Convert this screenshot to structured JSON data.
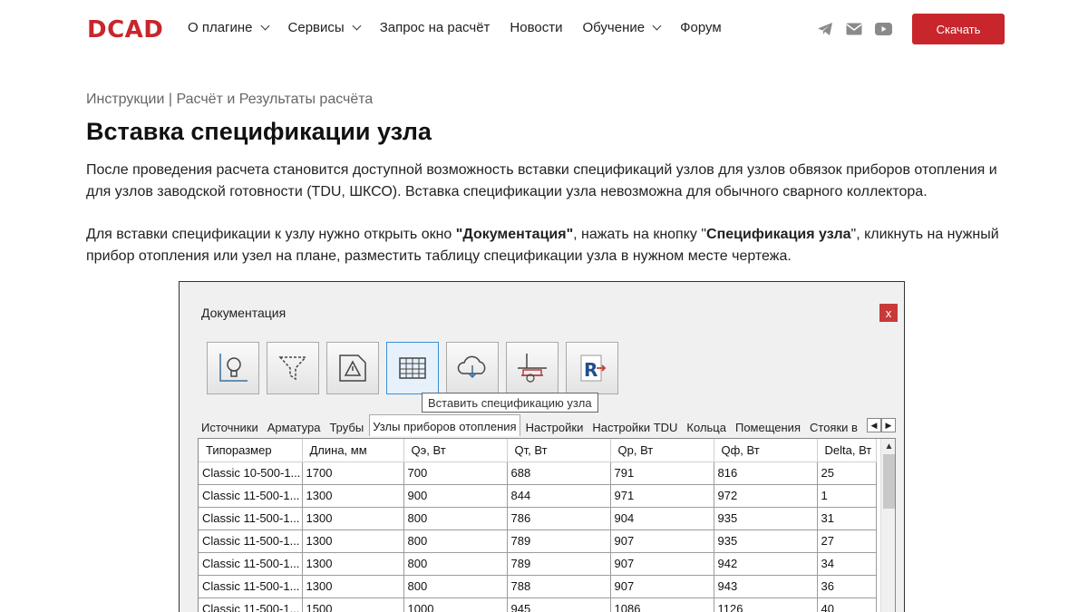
{
  "header": {
    "logo": "DCAD",
    "nav": [
      {
        "label": "О плагине",
        "dropdown": true
      },
      {
        "label": "Сервисы",
        "dropdown": true
      },
      {
        "label": "Запрос на расчёт",
        "dropdown": false
      },
      {
        "label": "Новости",
        "dropdown": false
      },
      {
        "label": "Обучение",
        "dropdown": true
      },
      {
        "label": "Форум",
        "dropdown": false
      }
    ],
    "social_icons": [
      "telegram-icon",
      "mail-icon",
      "youtube-icon"
    ],
    "download_label": "Скачать",
    "accent_color": "#c8262c"
  },
  "content": {
    "breadcrumb": "Инструкции | Расчёт и Результаты расчёта",
    "title": "Вставка спецификации узла",
    "para1": "После проведения расчета становится доступной возможность вставки спецификаций узлов для узлов обвязок приборов отопления и для узлов заводской готовности (TDU, ШКСО). Вставка спецификации узла невозможна для обычного сварного коллектора.",
    "para2_a": "Для вставки спецификации к узлу нужно открыть окно ",
    "para2_b": "\"Документация\"",
    "para2_c": ", нажать на кнопку \"",
    "para2_d": "Спецификация узла",
    "para2_e": "\", кликнуть на нужный прибор отопления или узел на плане, разместить таблицу спецификации узла в нужном месте чертежа."
  },
  "window": {
    "title": "Документация",
    "close": "x",
    "tools": [
      "bulb-icon",
      "filter-icon",
      "warning-icon",
      "table-icon",
      "cloud-download-icon",
      "pipe-node-icon",
      "revit-export-icon"
    ],
    "tooltip": "Вставить спецификацию узла",
    "tabs": [
      "Источники",
      "Арматура",
      "Трубы",
      "Узлы приборов отопления",
      "Настройки",
      "Настройки TDU",
      "Кольца",
      "Помещения",
      "Стояки в"
    ],
    "active_tab": 3,
    "columns": [
      "Типоразмер",
      "Длина, мм",
      "Qэ, Вт",
      "Qт, Вт",
      "Qр, Вт",
      "Qф, Вт",
      "Delta, Вт"
    ],
    "rows": [
      [
        "Classic 10-500-1...",
        "1700",
        "700",
        "688",
        "791",
        "816",
        "25"
      ],
      [
        "Classic 11-500-1...",
        "1300",
        "900",
        "844",
        "971",
        "972",
        "1"
      ],
      [
        "Classic 11-500-1...",
        "1300",
        "800",
        "786",
        "904",
        "935",
        "31"
      ],
      [
        "Classic 11-500-1...",
        "1300",
        "800",
        "789",
        "907",
        "935",
        "27"
      ],
      [
        "Classic 11-500-1...",
        "1300",
        "800",
        "789",
        "907",
        "942",
        "34"
      ],
      [
        "Classic 11-500-1...",
        "1300",
        "800",
        "788",
        "907",
        "943",
        "36"
      ],
      [
        "Classic 11-500-1...",
        "1500",
        "1000",
        "945",
        "1086",
        "1126",
        "40"
      ]
    ]
  }
}
